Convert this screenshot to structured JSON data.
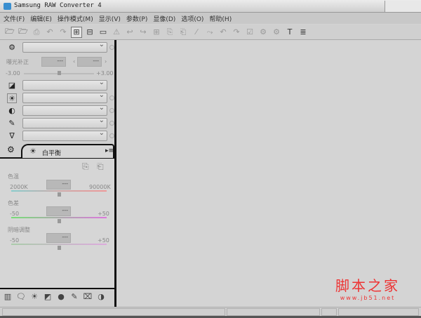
{
  "title": "Samsung RAW Converter 4",
  "menu": [
    "文件(F)",
    "编辑(E)",
    "操作模式(M)",
    "显示(V)",
    "参数(P)",
    "显像(D)",
    "选项(O)",
    "帮助(H)"
  ],
  "toolbar_icons": [
    [
      "folder-open-icon",
      "🗁",
      1
    ],
    [
      "folder-recent-icon",
      "🗁",
      1
    ],
    [
      "print-icon",
      "⎙",
      0
    ],
    [
      "undo-icon",
      "↶",
      0
    ],
    [
      "redo-icon",
      "↷",
      0
    ],
    [
      "grid-view-icon",
      "⊞",
      2
    ],
    [
      "split-view-icon",
      "⊟",
      1
    ],
    [
      "single-view-icon",
      "▭",
      1
    ],
    [
      "warning-icon",
      "⚠",
      0
    ],
    [
      "rotate-left-icon",
      "↩",
      0
    ],
    [
      "rotate-right-icon",
      "↪",
      0
    ],
    [
      "grid-icon",
      "⊞",
      0
    ],
    [
      "copy-settings-icon",
      "⎘",
      0
    ],
    [
      "paste-settings-icon",
      "⎗",
      0
    ],
    [
      "brush-icon",
      "⁄",
      0
    ],
    [
      "picker-icon",
      "⤳",
      0
    ],
    [
      "prev-icon",
      "↶",
      0
    ],
    [
      "next-icon",
      "↷",
      0
    ],
    [
      "check-icon",
      "☑",
      0
    ],
    [
      "settings-save-icon",
      "⚙",
      0
    ],
    [
      "settings-check-icon",
      "⚙",
      0
    ],
    [
      "tool-icon",
      "T",
      1
    ],
    [
      "notes-icon",
      "≣",
      1
    ]
  ],
  "exposure": {
    "label": "曝光补正",
    "value1": "---",
    "value2": "---",
    "min": "-3.00",
    "max": "+3.00"
  },
  "white_balance": {
    "tab_label": "白平衡",
    "temperature": {
      "label": "色温",
      "value": "---",
      "min": "2000K",
      "max": "90000K"
    },
    "tint": {
      "label": "色差",
      "value": "---",
      "min": "-50",
      "max": "+50"
    },
    "shadow": {
      "label": "阴暗调整",
      "value": "---",
      "min": "-50",
      "max": "+50"
    }
  },
  "watermark": {
    "text": "脚本之家",
    "url": "www.jb51.net"
  }
}
